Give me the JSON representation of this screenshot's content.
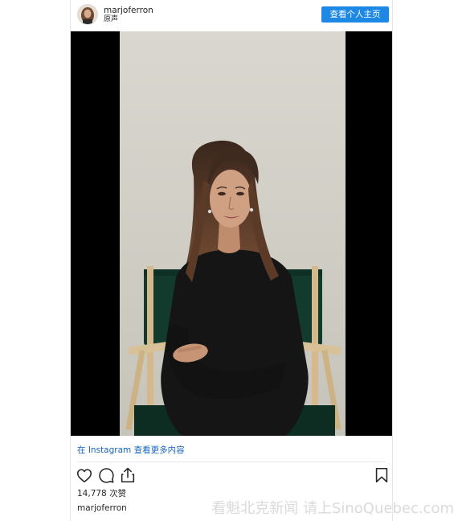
{
  "post": {
    "username": "marjoferron",
    "audio_label": "原声",
    "profile_button": "查看个人主页",
    "more_on_instagram": "在 Instagram 查看更多内容",
    "likes_count": "14,778",
    "likes_suffix": "次赞",
    "caption_username": "marjoferron"
  },
  "watermark": {
    "text": "看魁北克新闻 请上SinoQuebec.com"
  },
  "icons": {
    "like": "heart-icon",
    "comment": "comment-icon",
    "share": "share-icon",
    "save": "bookmark-icon"
  },
  "colors": {
    "button": "#1e88e5",
    "link": "#1565c0"
  }
}
